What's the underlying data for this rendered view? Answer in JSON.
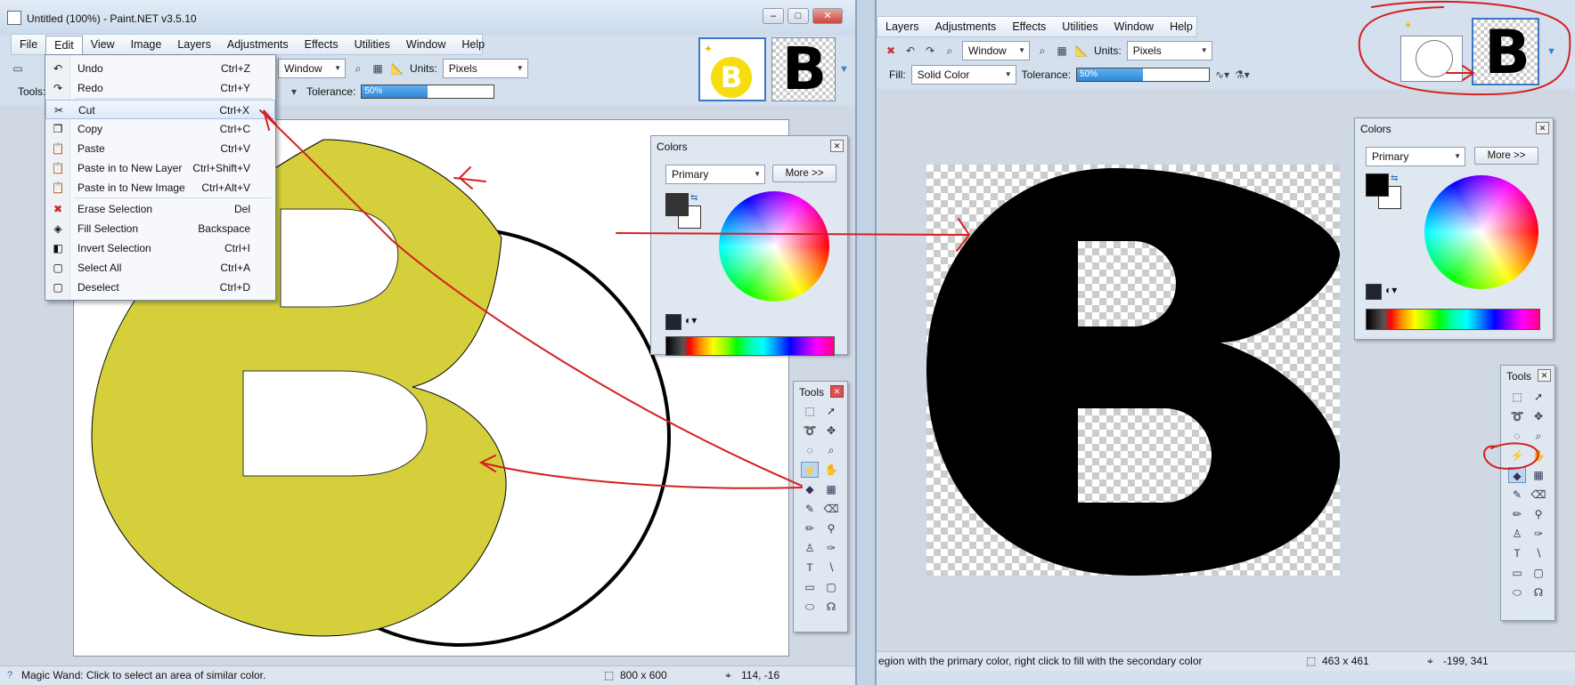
{
  "left_window": {
    "title": "Untitled (100%) - Paint.NET v3.5.10",
    "caption_buttons": [
      "–",
      "□",
      "✕"
    ],
    "menu": [
      "File",
      "Edit",
      "View",
      "Image",
      "Layers",
      "Adjustments",
      "Effects",
      "Utilities",
      "Window",
      "Help"
    ],
    "toolbar": {
      "window_combo": "Window",
      "units_label": "Units:",
      "units_value": "Pixels",
      "tools_label": "Tools:",
      "tolerance_label": "Tolerance:",
      "tolerance_value": "50%",
      "tolerance_fraction": 0.5
    },
    "edit_menu": [
      {
        "icon": "undo-icon",
        "glyph": "↶",
        "label": "Undo",
        "shortcut": "Ctrl+Z"
      },
      {
        "icon": "redo-icon",
        "glyph": "↷",
        "label": "Redo",
        "shortcut": "Ctrl+Y"
      },
      {
        "icon": "scissors-icon",
        "glyph": "✂",
        "label": "Cut",
        "shortcut": "Ctrl+X"
      },
      {
        "icon": "copy-icon",
        "glyph": "❐",
        "label": "Copy",
        "shortcut": "Ctrl+C"
      },
      {
        "icon": "paste-icon",
        "glyph": "📋",
        "label": "Paste",
        "shortcut": "Ctrl+V"
      },
      {
        "icon": "paste-layer-icon",
        "glyph": "📋",
        "label": "Paste in to New Layer",
        "shortcut": "Ctrl+Shift+V"
      },
      {
        "icon": "paste-image-icon",
        "glyph": "📋",
        "label": "Paste in to New Image",
        "shortcut": "Ctrl+Alt+V"
      },
      {
        "icon": "erase-selection-icon",
        "glyph": "✖",
        "label": "Erase Selection",
        "shortcut": "Del"
      },
      {
        "icon": "fill-selection-icon",
        "glyph": "◈",
        "label": "Fill Selection",
        "shortcut": "Backspace"
      },
      {
        "icon": "invert-selection-icon",
        "glyph": "◧",
        "label": "Invert Selection",
        "shortcut": "Ctrl+I"
      },
      {
        "icon": "select-all-icon",
        "glyph": "▢",
        "label": "Select All",
        "shortcut": "Ctrl+A"
      },
      {
        "icon": "deselect-icon",
        "glyph": "▢",
        "label": "Deselect",
        "shortcut": "Ctrl+D"
      }
    ],
    "canvas_letter": "B",
    "colors_panel": {
      "title": "Colors",
      "mode": "Primary",
      "more_label": "More >>",
      "primary_color": "#333333",
      "secondary_color": "#ffffff"
    },
    "tools_panel_title": "Tools",
    "status": {
      "hint": "Magic Wand: Click to select an area of similar color.",
      "size": "800 x 600",
      "coords": "114, -16"
    },
    "thumbnail_letter": "B",
    "fill_color": "#d4cf3a"
  },
  "right_window": {
    "menu": [
      "Layers",
      "Adjustments",
      "Effects",
      "Utilities",
      "Window",
      "Help"
    ],
    "toolbar": {
      "window_combo": "Window",
      "units_label": "Units:",
      "units_value": "Pixels",
      "fill_label": "Fill:",
      "fill_value": "Solid Color",
      "tolerance_label": "Tolerance:",
      "tolerance_value": "50%",
      "tolerance_fraction": 0.5
    },
    "canvas_letter": "B",
    "colors_panel": {
      "title": "Colors",
      "mode": "Primary",
      "more_label": "More >>",
      "primary_color": "#000000",
      "secondary_color": "#ffffff"
    },
    "tools_panel_title": "Tools",
    "status": {
      "hint": "egion with the primary color, right click to fill with the secondary color",
      "size": "463 x 461",
      "coords": "-199, 341"
    },
    "thumbnail_letter": "B"
  },
  "annotation_color": "#d42020"
}
